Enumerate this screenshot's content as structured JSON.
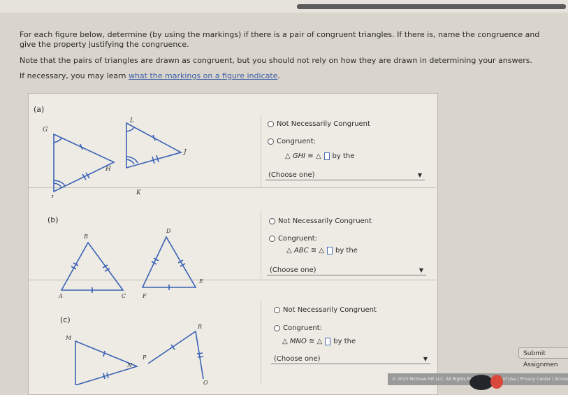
{
  "instructions": {
    "line1": "For each figure below, determine (by using the markings) if there is a pair of congruent triangles. If there is, name the congruence and give the property justifying the congruence.",
    "line2": "Note that the pairs of triangles are drawn as congruent, but you should not rely on how they are drawn in determining your answers.",
    "line3_prefix": "If necessary, you may learn ",
    "line3_link": "what the markings on a figure indicate",
    "line3_suffix": "."
  },
  "parts": [
    {
      "label": "(a)",
      "vertices": [
        "G",
        "H",
        "I",
        "L",
        "J",
        "K"
      ],
      "not_congruent_label": "Not Necessarily Congruent",
      "congruent_label": "Congruent:",
      "triangle_name": "△ GHI ≅ △",
      "by_label": "by the",
      "select_value": "(Choose one)"
    },
    {
      "label": "(b)",
      "vertices": [
        "B",
        "A",
        "C",
        "D",
        "E",
        "F"
      ],
      "not_congruent_label": "Not Necessarily Congruent",
      "congruent_label": "Congruent:",
      "triangle_name": "△ ABC ≅ △",
      "by_label": "by the",
      "select_value": "(Choose one)"
    },
    {
      "label": "(c)",
      "vertices": [
        "M",
        "N",
        "O",
        "R",
        "P"
      ],
      "not_congruent_label": "Not Necessarily Congruent",
      "congruent_label": "Congruent:",
      "triangle_name": "△ MNO ≅ △",
      "by_label": "by the",
      "select_value": "(Choose one)"
    }
  ],
  "submit_label": "Submit Assignmen",
  "footer_text": "© 2025 McGraw Hill LLC. All Rights Reserved.   Terms of Use  |  Privacy Center  |  Accessibi",
  "colors": {
    "link": "#3e5fa8",
    "figure_line": "#3a62b5",
    "marking": "#3a62b5"
  }
}
